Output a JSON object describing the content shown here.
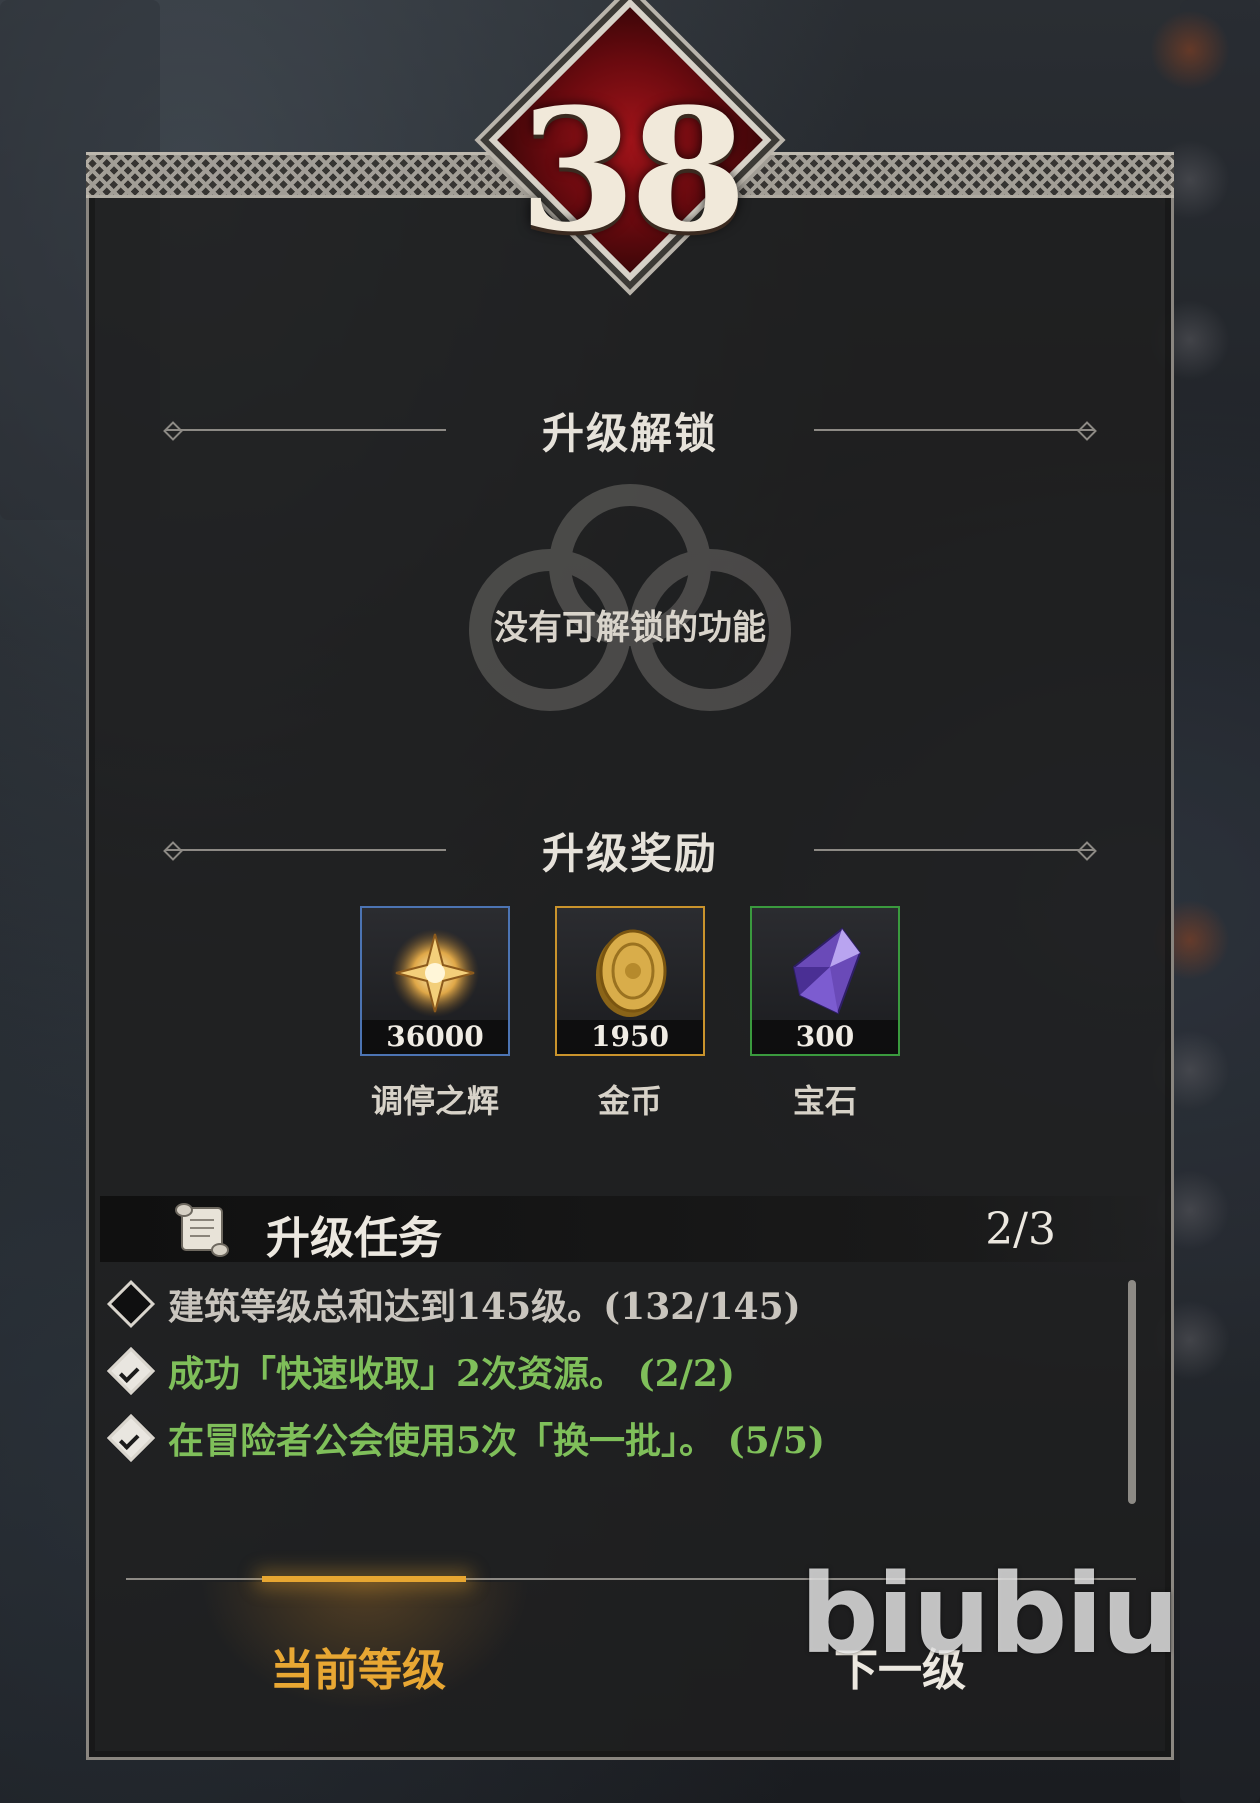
{
  "level": "38",
  "unlock": {
    "title": "升级解锁",
    "empty_text": "没有可解锁的功能"
  },
  "rewards": {
    "title": "升级奖励",
    "items": [
      {
        "name": "调停之辉",
        "amount": "36000",
        "icon": "glow-star-icon",
        "rarity_color": "#4c74b3"
      },
      {
        "name": "金币",
        "amount": "1950",
        "icon": "gold-coin-icon",
        "rarity_color": "#c9932c"
      },
      {
        "name": "宝石",
        "amount": "300",
        "icon": "purple-gem-icon",
        "rarity_color": "#3a9a3e"
      }
    ]
  },
  "tasks": {
    "title": "升级任务",
    "progress": "2/3",
    "items": [
      {
        "text": "建筑等级总和达到145级。(132/145)",
        "done": false
      },
      {
        "text": "成功「快速收取」2次资源。  (2/2)",
        "done": true
      },
      {
        "text": "在冒险者公会使用5次「换一批」。  (5/5)",
        "done": true
      }
    ]
  },
  "tabs": {
    "current": "当前等级",
    "next": "下一级"
  },
  "watermark": "biubiu",
  "colors": {
    "accent_gold": "#e8a733",
    "done_green": "#7fbf5a",
    "badge_red": "#a3141a"
  }
}
